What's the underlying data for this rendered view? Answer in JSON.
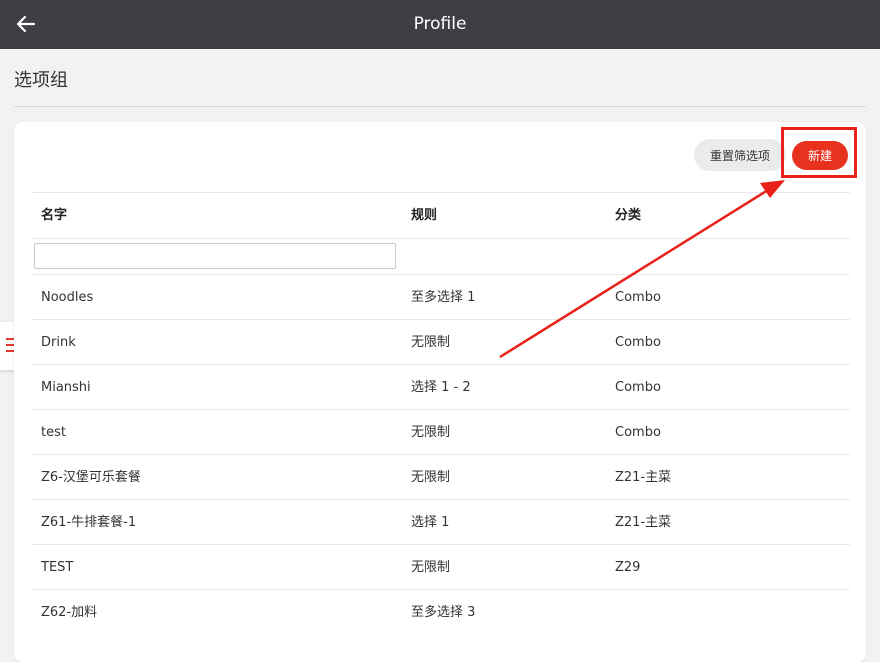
{
  "header": {
    "title": "Profile",
    "back_icon": "arrow-left-icon"
  },
  "page": {
    "title": "选项组"
  },
  "sidebar_toggle": {
    "icon": "hamburger-menu-icon",
    "color": "#e03a2f"
  },
  "toolbar": {
    "reset_label": "重置筛选项",
    "new_label": "新建",
    "new_color": "#e8321f"
  },
  "table": {
    "columns": [
      "名字",
      "规则",
      "分类"
    ],
    "filter": {
      "value": "",
      "placeholder": ""
    },
    "rows": [
      {
        "name": "Noodles",
        "rule": "至多选择 1",
        "category": "Combo"
      },
      {
        "name": "Drink",
        "rule": "无限制",
        "category": "Combo"
      },
      {
        "name": "Mianshi",
        "rule": "选择 1 - 2",
        "category": "Combo"
      },
      {
        "name": "test",
        "rule": "无限制",
        "category": "Combo"
      },
      {
        "name": "Z6-汉堡可乐套餐",
        "rule": "无限制",
        "category": "Z21-主菜"
      },
      {
        "name": "Z61-牛排套餐-1",
        "rule": "选择 1",
        "category": "Z21-主菜"
      },
      {
        "name": "TEST",
        "rule": "无限制",
        "category": "Z29"
      },
      {
        "name": "Z62-加料",
        "rule": "至多选择 3",
        "category": ""
      }
    ]
  },
  "annotation": {
    "color": "#e8221b"
  }
}
